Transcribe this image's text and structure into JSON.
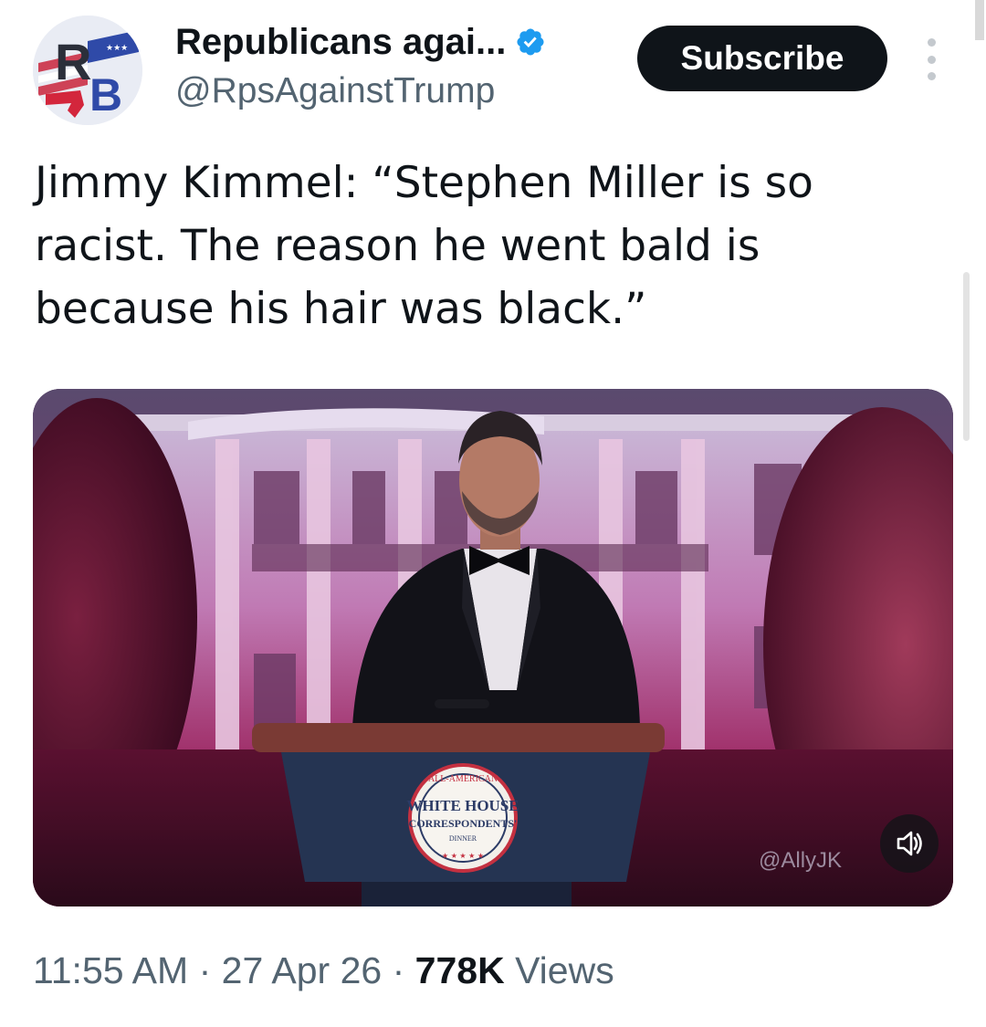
{
  "author": {
    "display_name": "Republicans agai...",
    "handle": "@RpsAgainstTrump",
    "verified": true,
    "avatar_text": "RB",
    "avatar_icon": "rb-monogram-logo"
  },
  "header": {
    "subscribe_label": "Subscribe",
    "more_icon": "vertical-ellipsis-icon"
  },
  "tweet": {
    "text": "Jimmy Kimmel: “Stephen Miller is so racist. The reason he went bald is because his hair was black.”"
  },
  "media": {
    "type": "video",
    "podium_seal_lines": [
      "ALL-AMERICAN",
      "WHITE HOUSE",
      "CORRESPONDENTS'",
      "DINNER"
    ],
    "watermark": "@AllyJK",
    "volume_icon": "speaker-muted-icon"
  },
  "meta": {
    "time": "11:55 AM",
    "separator": "·",
    "date": "27 Apr 26",
    "views_count": "778K",
    "views_label": "Views"
  },
  "colors": {
    "text": "#0f1419",
    "secondary_text": "#536471",
    "verified_badge": "#1d9bf0",
    "subscribe_bg": "#0f1419"
  }
}
